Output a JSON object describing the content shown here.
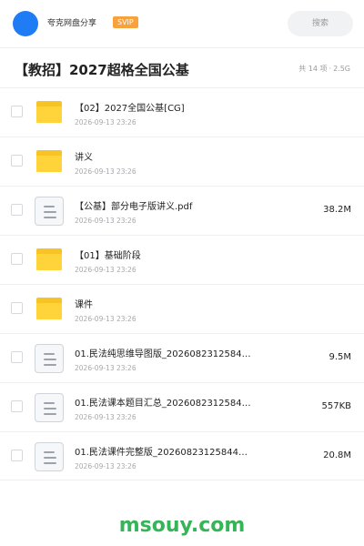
{
  "header": {
    "share_name": "夸克网盘分享",
    "badge": "SVIP",
    "search_placeholder": "搜索"
  },
  "folder": {
    "title": "【教招】2027超格全国公基",
    "count_text": "共 14 项",
    "separator": "·",
    "total_size": "2.5G"
  },
  "files": [
    {
      "name": "【02】2027全国公基[CG]",
      "date": "2026-09-13 23:26",
      "size": "",
      "type": "folder"
    },
    {
      "name": "讲义",
      "date": "2026-09-13 23:26",
      "size": "",
      "type": "folder"
    },
    {
      "name": "【公基】部分电子版讲义.pdf",
      "date": "2026-09-13 23:26",
      "size": "38.2M",
      "type": "file"
    },
    {
      "name": "【01】基础阶段",
      "date": "2026-09-13 23:26",
      "size": "",
      "type": "folder"
    },
    {
      "name": "课件",
      "date": "2026-09-13 23:26",
      "size": "",
      "type": "folder"
    },
    {
      "name": "01.民法纯思维导图版_2026082312584…",
      "date": "2026-09-13 23:26",
      "size": "9.5M",
      "type": "file"
    },
    {
      "name": "01.民法课本题目汇总_2026082312584…",
      "date": "2026-09-13 23:26",
      "size": "557KB",
      "type": "file"
    },
    {
      "name": "01.民法课件完整版_20260823125844…",
      "date": "2026-09-13 23:26",
      "size": "20.8M",
      "type": "file"
    }
  ],
  "watermark": "msouy.com",
  "colors": {
    "avatar": "#1f7cf5",
    "badge": "#f7a23c",
    "folder": "#ffd43b",
    "watermark": "#35b558"
  }
}
